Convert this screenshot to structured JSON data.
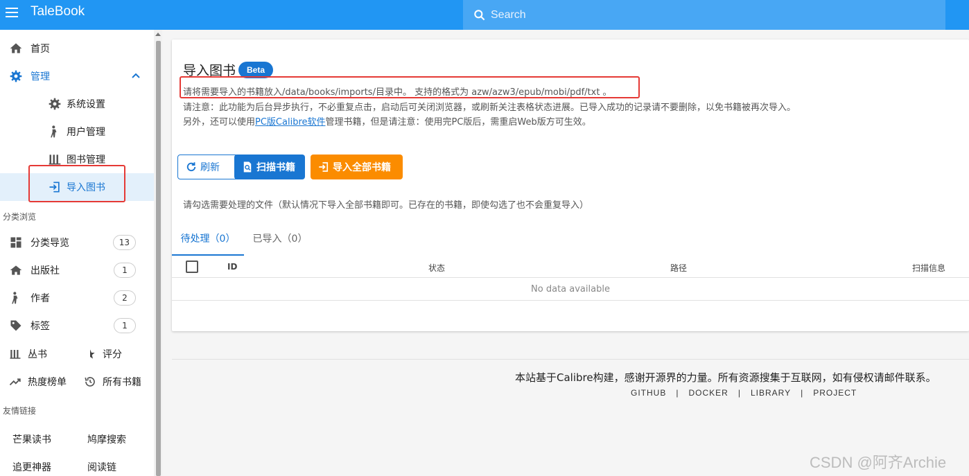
{
  "app": {
    "title": "TaleBook"
  },
  "search": {
    "placeholder": "Search"
  },
  "sidebar": {
    "home": "首页",
    "admin": "管理",
    "admin_items": [
      "系统设置",
      "用户管理",
      "图书管理",
      "导入图书"
    ],
    "section_browse": "分类浏览",
    "browse_items": [
      {
        "label": "分类导览",
        "count": "13"
      },
      {
        "label": "出版社",
        "count": "1"
      },
      {
        "label": "作者",
        "count": "2"
      },
      {
        "label": "标签",
        "count": "1"
      }
    ],
    "series": "丛书",
    "rating": "评分",
    "hot": "热度榜单",
    "all_books": "所有书籍",
    "section_links": "友情链接",
    "links": [
      "芒果读书",
      "鸠摩搜索",
      "追更神器",
      "阅读链"
    ]
  },
  "page": {
    "title": "导入图书",
    "badge": "Beta",
    "line1": "请将需要导入的书籍放入/data/books/imports/目录中。 支持的格式为 azw/azw3/epub/mobi/pdf/txt 。",
    "line2": "请注意：此功能为后台异步执行，不必重复点击，启动后可关闭浏览器，或刷新关注表格状态进展。已导入成功的记录请不要删除，以免书籍被再次导入。",
    "line3_pre": "另外，还可以使用",
    "line3_link": "PC版Calibre软件",
    "line3_post": "管理书籍，但是请注意：使用完PC版后，需重启Web版方可生效。",
    "btn_refresh": "刷新",
    "btn_scan": "扫描书籍",
    "btn_import_all": "导入全部书籍",
    "hint": "请勾选需要处理的文件（默认情况下导入全部书籍即可。已存在的书籍，即使勾选了也不会重复导入）",
    "tab_pending": "待处理（0）",
    "tab_imported": "已导入（0）",
    "columns": [
      "ID",
      "状态",
      "路径",
      "扫描信息"
    ],
    "empty": "No data available"
  },
  "footer": {
    "text": "本站基于Calibre构建，感谢开源界的力量。所有资源搜集于互联网，如有侵权请邮件联系。",
    "links": [
      "GITHUB",
      "DOCKER",
      "LIBRARY",
      "PROJECT"
    ],
    "sep": "|"
  },
  "watermark": "CSDN @阿齐Archie",
  "colors": {
    "primary": "#2196f3",
    "accent": "#1976d2",
    "orange": "#fb8c00",
    "highlight": "#e53935"
  }
}
